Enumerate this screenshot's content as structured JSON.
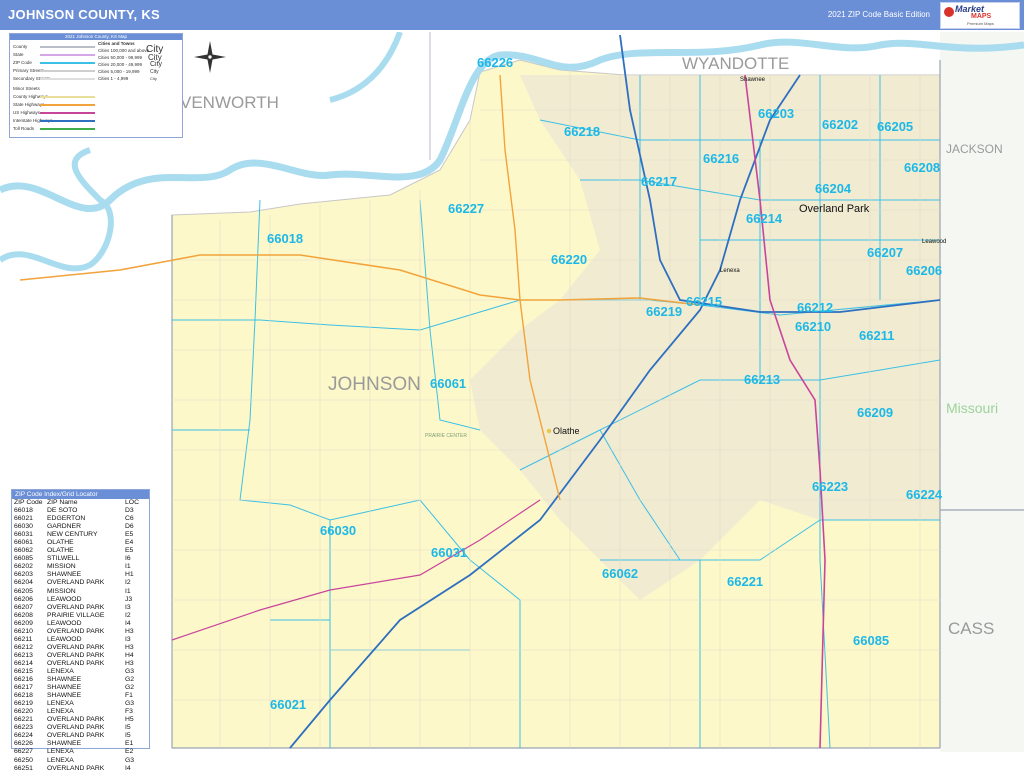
{
  "header": {
    "title": "JOHNSON COUNTY, KS",
    "edition": "2021 ZIP Code Basic Edition",
    "logo": {
      "line1": "Market",
      "line2": "MAPS",
      "line3": "Premium Maps"
    }
  },
  "colors": {
    "header_bg": "#6b8fd6",
    "county_fill": "#fdf8c9",
    "zip_label": "#1cb8e8",
    "zip_boundary": "#3cc0e6",
    "river": "#a9dcef",
    "interstate": "#2e6fc0",
    "us_highway": "#c8459c",
    "state_highway": "#f2a33c"
  },
  "counties": {
    "wyandotte": "WYANDOTTE",
    "leavenworth": "VENWORTH",
    "jackson": "JACKSON",
    "johnson": "JOHNSON",
    "cass": "CASS",
    "missouri": "Missouri"
  },
  "cities": {
    "overland_park": "Overland Park",
    "olathe": "Olathe",
    "shawnee": "Shawnee",
    "lenexa": "Lenexa",
    "leawood": "Leawood",
    "prairie_center": "PRAIRIE CENTER"
  },
  "zip_labels": [
    "66226",
    "66218",
    "66216",
    "66217",
    "66203",
    "66202",
    "66205",
    "66208",
    "66204",
    "66214",
    "66227",
    "66018",
    "66220",
    "66207",
    "66206",
    "66215",
    "66219",
    "66212",
    "66210",
    "66211",
    "66061",
    "66213",
    "66209",
    "66223",
    "66224",
    "66030",
    "66031",
    "66062",
    "66221",
    "66085",
    "66021"
  ],
  "legend": {
    "title": "2021 Johnson County, KS Map",
    "items": [
      "County",
      "State",
      "ZIP Code",
      "Primary Streets",
      "Secondary Streets",
      "Minor Streets",
      "County Highways",
      "State Highways",
      "US Highways",
      "Interstate Highways",
      "Toll Roads"
    ],
    "cities_title": "Cities and Towns",
    "city_sizes": [
      "Cities 100,000 and above",
      "Cities 50,000 - 99,999",
      "Cities 20,000 - 49,999",
      "Cities 5,000 - 19,999",
      "Cities 1 - 4,999"
    ],
    "city_samples": [
      "City",
      "City",
      "City",
      "City",
      "City"
    ]
  },
  "locator": {
    "title": "ZIP Code Index/Grid Locator",
    "headers": [
      "ZIP Code",
      "ZIP Name",
      "LOC"
    ],
    "rows": [
      [
        "66018",
        "DE SOTO",
        "D3"
      ],
      [
        "66021",
        "EDGERTON",
        "C6"
      ],
      [
        "66030",
        "GARDNER",
        "D6"
      ],
      [
        "66031",
        "NEW CENTURY",
        "E5"
      ],
      [
        "66061",
        "OLATHE",
        "E4"
      ],
      [
        "66062",
        "OLATHE",
        "E5"
      ],
      [
        "66085",
        "STILWELL",
        "I6"
      ],
      [
        "66202",
        "MISSION",
        "I1"
      ],
      [
        "66203",
        "SHAWNEE",
        "H1"
      ],
      [
        "66204",
        "OVERLAND PARK",
        "I2"
      ],
      [
        "66205",
        "MISSION",
        "I1"
      ],
      [
        "66206",
        "LEAWOOD",
        "J3"
      ],
      [
        "66207",
        "OVERLAND PARK",
        "I3"
      ],
      [
        "66208",
        "PRAIRIE VILLAGE",
        "I2"
      ],
      [
        "66209",
        "LEAWOOD",
        "I4"
      ],
      [
        "66210",
        "OVERLAND PARK",
        "H3"
      ],
      [
        "66211",
        "LEAWOOD",
        "I3"
      ],
      [
        "66212",
        "OVERLAND PARK",
        "H3"
      ],
      [
        "66213",
        "OVERLAND PARK",
        "H4"
      ],
      [
        "66214",
        "OVERLAND PARK",
        "H3"
      ],
      [
        "66215",
        "LENEXA",
        "G3"
      ],
      [
        "66216",
        "SHAWNEE",
        "G2"
      ],
      [
        "66217",
        "SHAWNEE",
        "G2"
      ],
      [
        "66218",
        "SHAWNEE",
        "F1"
      ],
      [
        "66219",
        "LENEXA",
        "G3"
      ],
      [
        "66220",
        "LENEXA",
        "F3"
      ],
      [
        "66221",
        "OVERLAND PARK",
        "H5"
      ],
      [
        "66223",
        "OVERLAND PARK",
        "I5"
      ],
      [
        "66224",
        "OVERLAND PARK",
        "I5"
      ],
      [
        "66226",
        "SHAWNEE",
        "E1"
      ],
      [
        "66227",
        "LENEXA",
        "E2"
      ],
      [
        "66250",
        "LENEXA",
        "G3"
      ],
      [
        "66251",
        "OVERLAND PARK",
        "I4"
      ]
    ]
  }
}
